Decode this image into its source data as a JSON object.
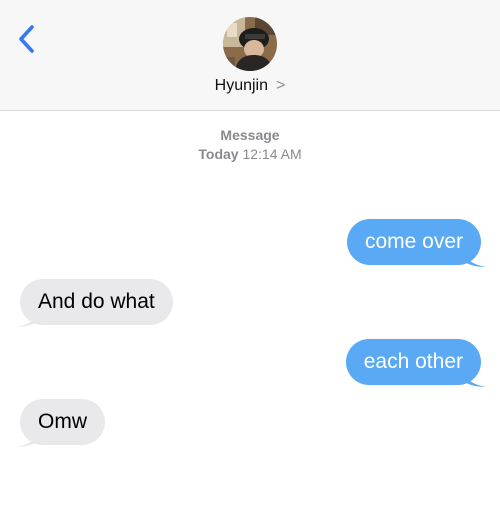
{
  "header": {
    "back_icon": "chevron-left-icon",
    "contact_name": "Hyunjin",
    "contact_chevron": ">",
    "accent": "#3478f6"
  },
  "meta": {
    "service": "Message",
    "day": "Today",
    "time": "12:14 AM"
  },
  "messages": [
    {
      "direction": "outgoing",
      "text": "come over",
      "color": "#5aa9f5"
    },
    {
      "direction": "incoming",
      "text": "And do what",
      "color": "#e9e9eb"
    },
    {
      "direction": "outgoing",
      "text": "each other",
      "color": "#5aa9f5"
    },
    {
      "direction": "incoming",
      "text": "Omw",
      "color": "#e9e9eb"
    }
  ]
}
